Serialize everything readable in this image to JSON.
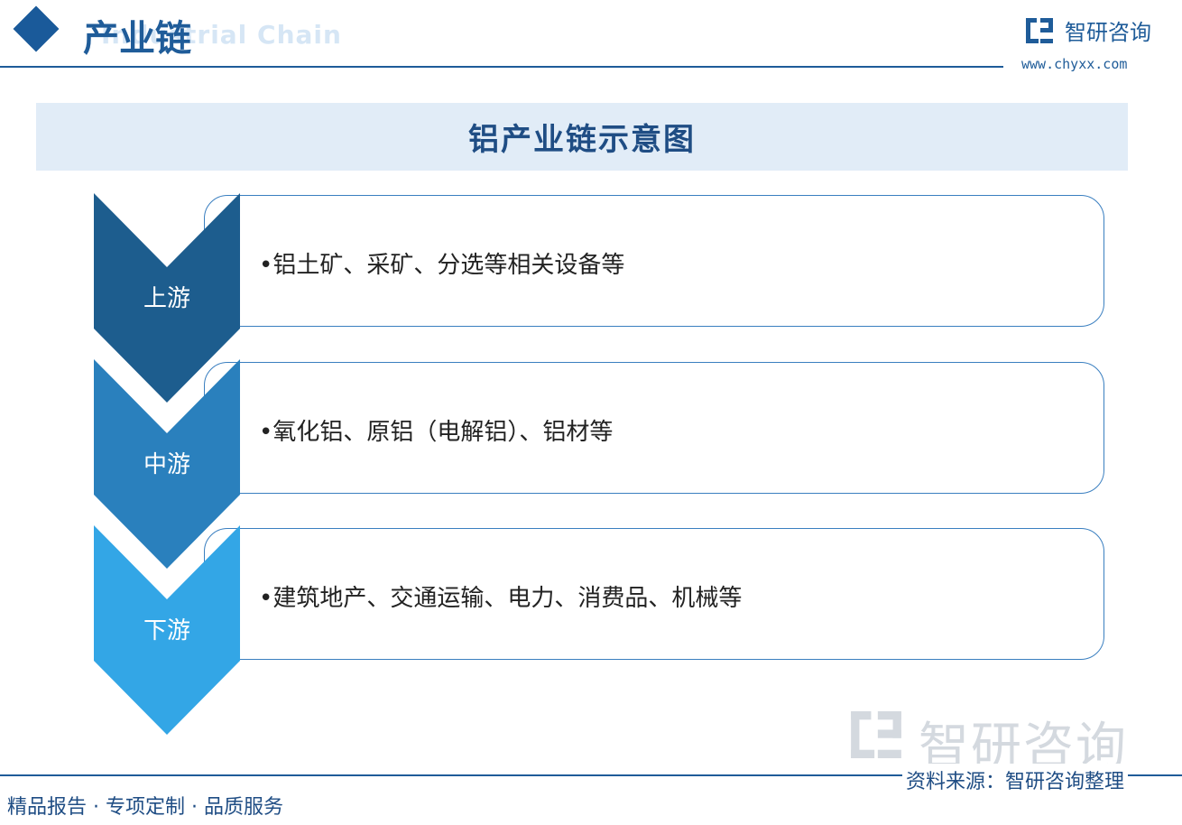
{
  "header": {
    "title": "产业链",
    "subtitle_en": "Industrial Chain",
    "brand_name": "智研咨询",
    "brand_url": "www.chyxx.com"
  },
  "diagram": {
    "title": "铝产业链示意图",
    "stages": [
      {
        "label": "上游",
        "content": "•铝土矿、采矿、分选等相关设备等",
        "color": "#1d5d8e"
      },
      {
        "label": "中游",
        "content": "•氧化铝、原铝（电解铝）、铝材等",
        "color": "#2a80bd"
      },
      {
        "label": "下游",
        "content": "•建筑地产、交通运输、电力、消费品、机械等",
        "color": "#33a6e6"
      }
    ]
  },
  "watermark": {
    "text": "智研咨询"
  },
  "footer": {
    "tagline": "精品报告 · 专项定制 · 品质服务",
    "source": "资料来源：智研咨询整理"
  },
  "colors": {
    "primary": "#1f5c99",
    "banner_bg": "#e1ecf7",
    "box_border": "#3a7fc0"
  }
}
